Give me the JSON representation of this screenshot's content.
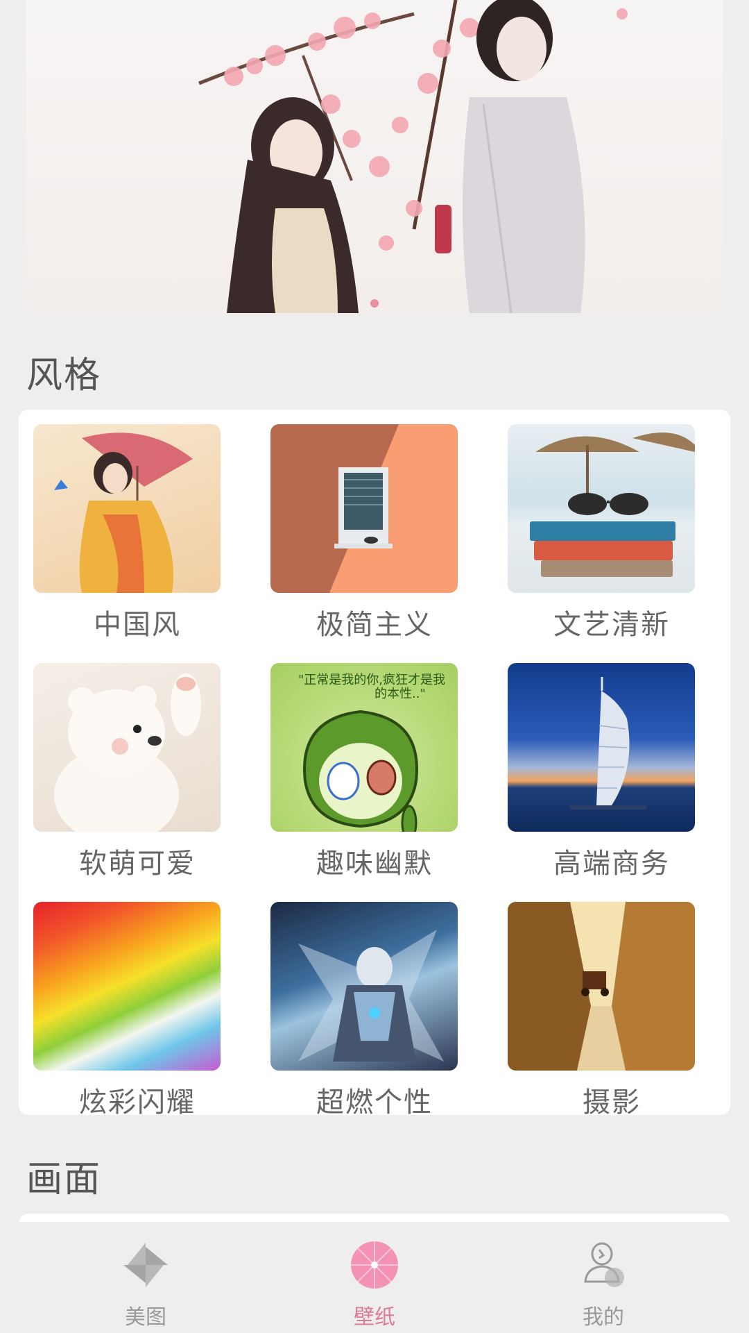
{
  "banner": {
    "slides": 3,
    "active_slide": 1
  },
  "sections": [
    {
      "title": "风格"
    },
    {
      "title": "画面"
    }
  ],
  "styles": [
    {
      "label": "中国风",
      "icon": "chinese-style-thumbnail"
    },
    {
      "label": "极简主义",
      "icon": "minimalism-thumbnail"
    },
    {
      "label": "文艺清新",
      "icon": "literary-fresh-thumbnail"
    },
    {
      "label": "软萌可爱",
      "icon": "cute-thumbnail"
    },
    {
      "label": "趣味幽默",
      "icon": "humor-thumbnail"
    },
    {
      "label": "高端商务",
      "icon": "business-thumbnail"
    },
    {
      "label": "炫彩闪耀",
      "icon": "colorful-thumbnail"
    },
    {
      "label": "超燃个性",
      "icon": "personality-thumbnail"
    },
    {
      "label": "摄影",
      "icon": "photography-thumbnail"
    }
  ],
  "nav": [
    {
      "label": "美图",
      "icon": "pinwheel-icon",
      "active": false
    },
    {
      "label": "壁纸",
      "icon": "umbrella-icon",
      "active": true
    },
    {
      "label": "我的",
      "icon": "profile-icon",
      "active": false
    }
  ],
  "colors": {
    "accent": "#e07a93",
    "background": "#efeeef"
  }
}
